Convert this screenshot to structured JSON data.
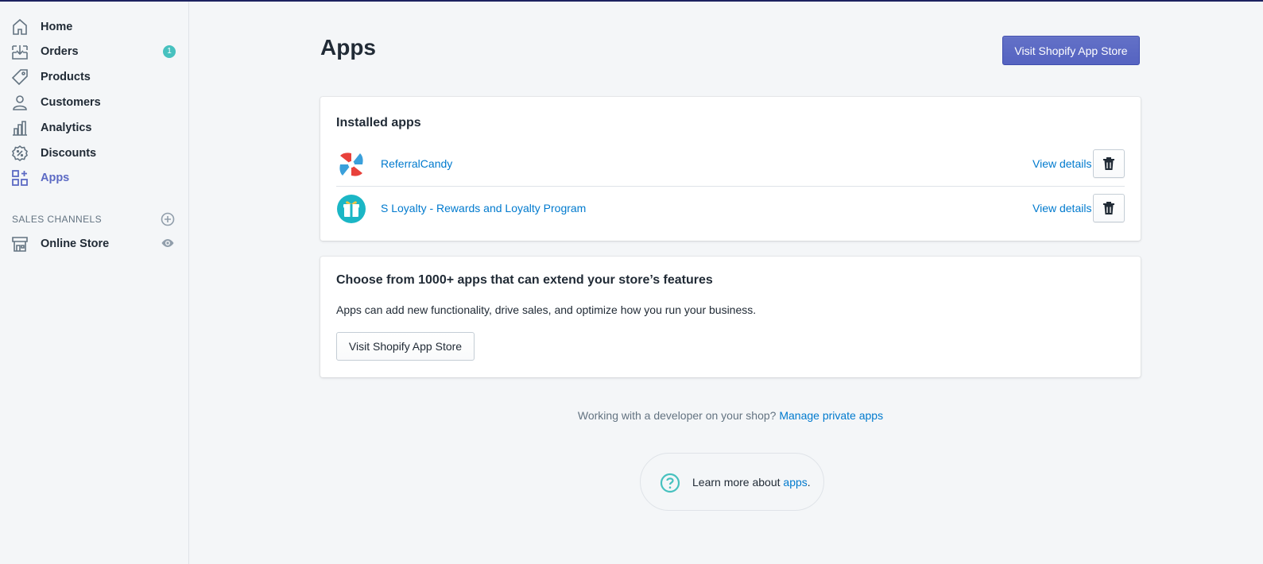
{
  "sidebar": {
    "items": [
      {
        "label": "Home",
        "icon": "home-icon"
      },
      {
        "label": "Orders",
        "icon": "orders-icon",
        "badge": "1"
      },
      {
        "label": "Products",
        "icon": "tag-icon"
      },
      {
        "label": "Customers",
        "icon": "person-icon"
      },
      {
        "label": "Analytics",
        "icon": "bar-chart-icon"
      },
      {
        "label": "Discounts",
        "icon": "discount-icon"
      },
      {
        "label": "Apps",
        "icon": "apps-icon",
        "active": true
      }
    ],
    "channels_title": "SALES CHANNELS",
    "channels": [
      {
        "label": "Online Store",
        "icon": "store-icon"
      }
    ]
  },
  "main": {
    "title": "Apps",
    "primary_button": "Visit Shopify App Store",
    "installed": {
      "title": "Installed apps",
      "apps": [
        {
          "name": "ReferralCandy",
          "action": "View details"
        },
        {
          "name": "S Loyalty - Rewards and Loyalty Program",
          "action": "View details"
        }
      ]
    },
    "promo": {
      "title": "Choose from 1000+ apps that can extend your store’s features",
      "text": "Apps can add new functionality, drive sales, and optimize how you run your business.",
      "button": "Visit Shopify App Store"
    },
    "footer": {
      "text": "Working with a developer on your shop? ",
      "link": "Manage private apps"
    },
    "learn_more": {
      "text": "Learn more about ",
      "link": "apps",
      "suffix": "."
    }
  },
  "colors": {
    "accent": "#5c6ac4",
    "link": "#007ace",
    "badge": "#47c1bf"
  }
}
